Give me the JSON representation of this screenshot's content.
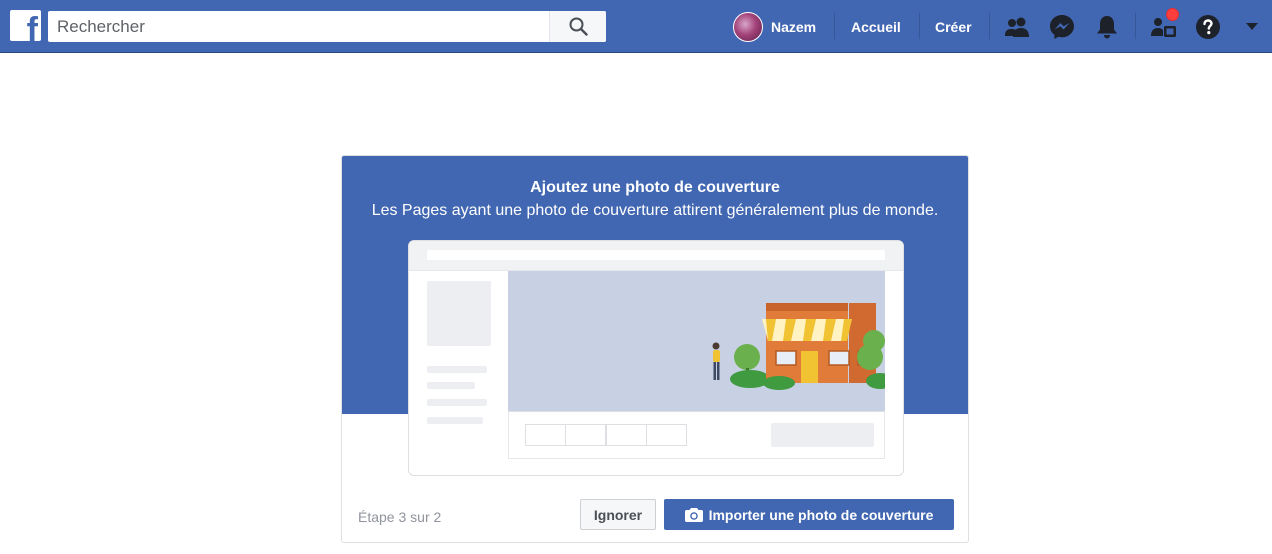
{
  "header": {
    "logo_icon": "facebook-logo-icon",
    "search": {
      "placeholder": "Rechercher",
      "value": "",
      "icon": "search-icon"
    },
    "profile_name": "Nazem",
    "home_label": "Accueil",
    "create_label": "Créer",
    "icons": [
      "friends-icon",
      "messenger-icon",
      "notifications-bell-icon",
      "groups-icon",
      "help-icon",
      "dropdown-caret-icon"
    ],
    "has_notification_badge": true
  },
  "card": {
    "title": "Ajoutez une photo de couverture",
    "subtitle": "Les Pages ayant une photo de couverture attirent généralement plus de monde.",
    "illustration": "page-cover-mockup-storefront",
    "step_text": "Étape 3 sur 2",
    "ignore_label": "Ignorer",
    "import_label": "Importer une photo de couverture",
    "import_icon": "camera-icon"
  },
  "colors": {
    "brand_blue": "#4267b2",
    "cover_placeholder": "#c8d0e4",
    "notification_red": "#fa3e3e"
  }
}
